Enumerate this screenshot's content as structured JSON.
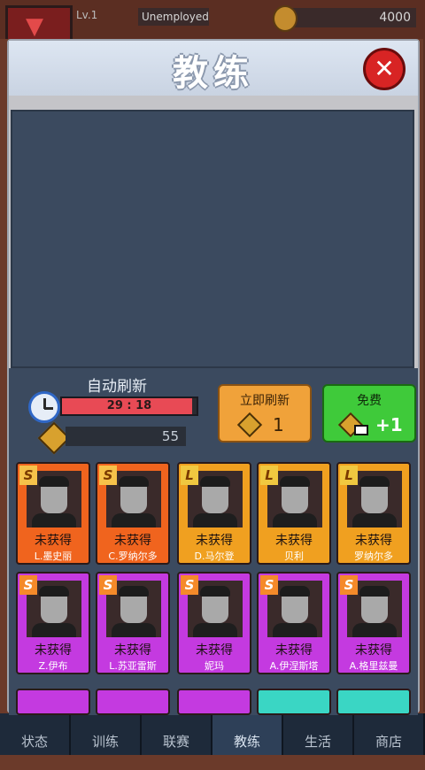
{
  "hud": {
    "level": "Lv.1",
    "job": "Unemployed",
    "money": "4000"
  },
  "dialog": {
    "title": "教练",
    "close_icon": "close-icon"
  },
  "refresh": {
    "title": "自动刷新",
    "timer": "29 : 18",
    "timer_progress": 0.97,
    "gems": "55",
    "refresh_now_label": "立即刷新",
    "refresh_now_cost": "1",
    "free_label": "免费",
    "free_reward": "+1"
  },
  "colors": {
    "sp_card": "#f0641e",
    "l_card": "#f0a020",
    "s_card": "#c43ae0",
    "accent_red": "#d82424",
    "accent_green": "#3fca3a",
    "accent_orange": "#f0a23a"
  },
  "cards": [
    {
      "rank": "S",
      "status": "未获得",
      "name": "L.墨史丽"
    },
    {
      "rank": "S",
      "status": "未获得",
      "name": "C.罗纳尔多"
    },
    {
      "rank": "L",
      "status": "未获得",
      "name": "D.马尔登"
    },
    {
      "rank": "L",
      "status": "未获得",
      "name": "贝利"
    },
    {
      "rank": "L",
      "status": "未获得",
      "name": "罗纳尔多"
    },
    {
      "rank": "S",
      "status": "未获得",
      "name": "Z.伊布"
    },
    {
      "rank": "S",
      "status": "未获得",
      "name": "L.苏亚雷斯"
    },
    {
      "rank": "S",
      "status": "未获得",
      "name": "妮玛"
    },
    {
      "rank": "S",
      "status": "未获得",
      "name": "A.伊涅斯塔"
    },
    {
      "rank": "S",
      "status": "未获得",
      "name": "A.格里兹曼"
    }
  ],
  "nav": [
    "状态",
    "训练",
    "联赛",
    "教练",
    "生活",
    "商店"
  ]
}
